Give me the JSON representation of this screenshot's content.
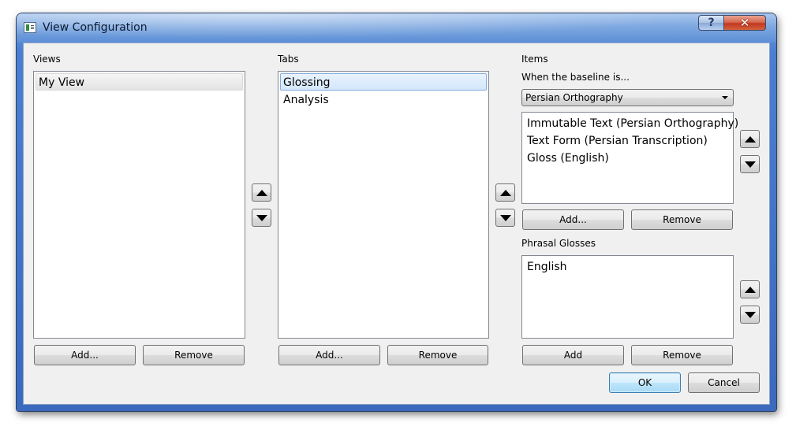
{
  "window": {
    "title": "View Configuration",
    "help_label": "?",
    "close_label": "✕"
  },
  "views": {
    "label": "Views",
    "items": [
      "My View"
    ],
    "add_label": "Add...",
    "remove_label": "Remove"
  },
  "tabs": {
    "label": "Tabs",
    "items": [
      "Glossing",
      "Analysis"
    ],
    "add_label": "Add...",
    "remove_label": "Remove"
  },
  "items": {
    "label": "Items",
    "baseline_label": "When the baseline is...",
    "baseline_value": "Persian Orthography",
    "list": [
      "Immutable Text (Persian Orthography)",
      "Text Form (Persian Transcription)",
      "Gloss (English)"
    ],
    "add_label": "Add...",
    "remove_label": "Remove"
  },
  "phrasal": {
    "label": "Phrasal Glosses",
    "list": [
      "English"
    ],
    "add_label": "Add",
    "remove_label": "Remove"
  },
  "footer": {
    "ok_label": "OK",
    "cancel_label": "Cancel"
  }
}
